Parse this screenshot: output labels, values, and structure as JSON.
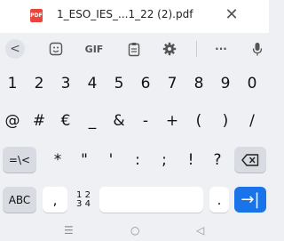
{
  "notification": {
    "file_name": "1_ESO_IES_...1_22 (2).pdf",
    "badge": "PDF",
    "close_glyph": "✕"
  },
  "toolbar": {
    "back": "<",
    "gif": "GIF",
    "more": "···"
  },
  "rows": {
    "numbers": [
      "1",
      "2",
      "3",
      "4",
      "5",
      "6",
      "7",
      "8",
      "9",
      "0"
    ],
    "symbols1": [
      "@",
      "#",
      "€",
      "_",
      "&",
      "-",
      "+",
      "(",
      ")",
      "/"
    ],
    "symbols2": [
      "=\\<",
      "*",
      "\"",
      "'",
      ":",
      ";",
      "!",
      "?"
    ],
    "bottom": {
      "abc": "ABC",
      "comma": ",",
      "num_top": "1 2",
      "num_bottom": "3 4",
      "period": ".",
      "enter": "→|"
    }
  },
  "nav": {
    "recents": "☰",
    "home": "○",
    "back": "◁"
  },
  "colors": {
    "accent": "#1a73e8",
    "pdf_red": "#e8453c"
  }
}
